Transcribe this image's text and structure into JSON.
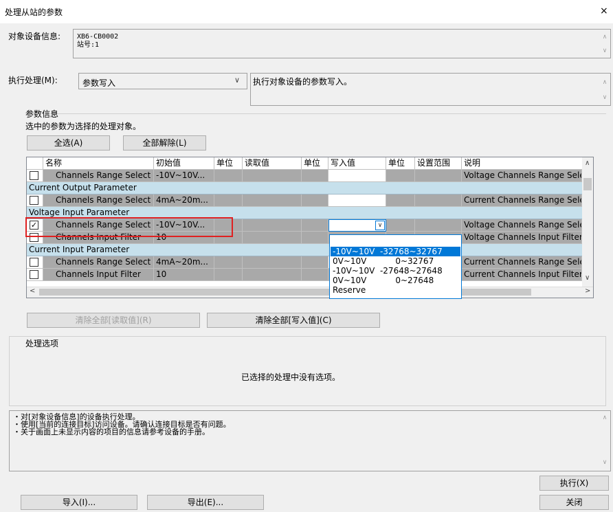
{
  "window": {
    "title": "处理从站的参数",
    "close_glyph": "×"
  },
  "device_info": {
    "label": "对象设备信息:",
    "line1": "XB6-CB0002",
    "line2": "站号:1"
  },
  "process": {
    "label": "执行处理(M):",
    "selected": "参数写入",
    "description": "执行对象设备的参数写入。"
  },
  "param_info": {
    "group_label": "参数信息",
    "hint": "选中的参数为选择的处理对象。",
    "select_all": "全选(A)",
    "deselect_all": "全部解除(L)"
  },
  "table": {
    "headers": [
      "名称",
      "初始值",
      "单位",
      "读取值",
      "单位",
      "写入值",
      "单位",
      "设置范围",
      "说明"
    ],
    "rows": [
      {
        "type": "item",
        "checked": false,
        "name": "Channels Range Select",
        "initial": "-10V~10V...",
        "desc": "Voltage Channels Range Select"
      },
      {
        "type": "group",
        "name": "Current Output Parameter"
      },
      {
        "type": "item",
        "checked": false,
        "name": "Channels Range Select",
        "initial": "4mA~20m...",
        "desc": "Current Channels Range Select"
      },
      {
        "type": "group",
        "name": "Voltage Input Parameter"
      },
      {
        "type": "item",
        "checked": true,
        "name": "Channels Range Select",
        "initial": "-10V~10V...",
        "desc": "Voltage Channels Range Select"
      },
      {
        "type": "item",
        "checked": false,
        "name": "Channels Input Filter",
        "initial": "10",
        "desc": "Voltage Channels Input Filter Se"
      },
      {
        "type": "group",
        "name": "Current Input Parameter"
      },
      {
        "type": "item",
        "checked": false,
        "name": "Channels Range Select",
        "initial": "4mA~20m...",
        "desc": "Current Channels Range Select"
      },
      {
        "type": "item",
        "checked": false,
        "name": "Channels Input Filter",
        "initial": "10",
        "desc": "Current Channels Input Filter Se"
      }
    ]
  },
  "dropdown": {
    "options": [
      "-10V~10V  -32768~32767",
      "0V~10V           0~32767",
      "-10V~10V  -27648~27648",
      "0V~10V           0~27648",
      "Reserve"
    ],
    "selected_index": 0
  },
  "clear": {
    "read": "清除全部[读取值](R)",
    "write": "清除全部[写入值](C)"
  },
  "options": {
    "group_label": "处理选项",
    "empty": "已选择的处理中没有选项。"
  },
  "notes": [
    "・对[对象设备信息]的设备执行处理。",
    "・使用[当前的连接目标]访问设备。请确认连接目标是否有问题。",
    "・关于画面上未显示内容的项目的信息请参考设备的手册。"
  ],
  "buttons": {
    "execute": "执行(X)",
    "import": "导入(I)...",
    "export": "导出(E)...",
    "close": "关闭"
  },
  "colors": {
    "highlight": "#e02020",
    "group_row": "#c6e0ec",
    "selection": "#0078d7",
    "readonly_cell": "#a9a9a9"
  }
}
